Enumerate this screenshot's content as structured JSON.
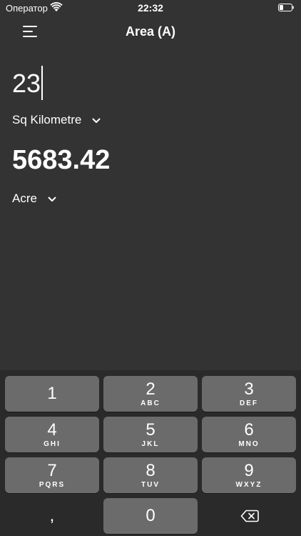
{
  "status_bar": {
    "carrier": "Оператор",
    "time": "22:32"
  },
  "nav": {
    "title": "Area (A)"
  },
  "converter": {
    "input_value": "23",
    "from_unit": "Sq Kilometre",
    "result_value": "5683.42",
    "to_unit": "Acre"
  },
  "keypad": {
    "k1": {
      "num": "1",
      "letters": ""
    },
    "k2": {
      "num": "2",
      "letters": "ABC"
    },
    "k3": {
      "num": "3",
      "letters": "DEF"
    },
    "k4": {
      "num": "4",
      "letters": "GHI"
    },
    "k5": {
      "num": "5",
      "letters": "JKL"
    },
    "k6": {
      "num": "6",
      "letters": "MNO"
    },
    "k7": {
      "num": "7",
      "letters": "PQRS"
    },
    "k8": {
      "num": "8",
      "letters": "TUV"
    },
    "k9": {
      "num": "9",
      "letters": "WXYZ"
    },
    "comma": ",",
    "k0": "0"
  }
}
